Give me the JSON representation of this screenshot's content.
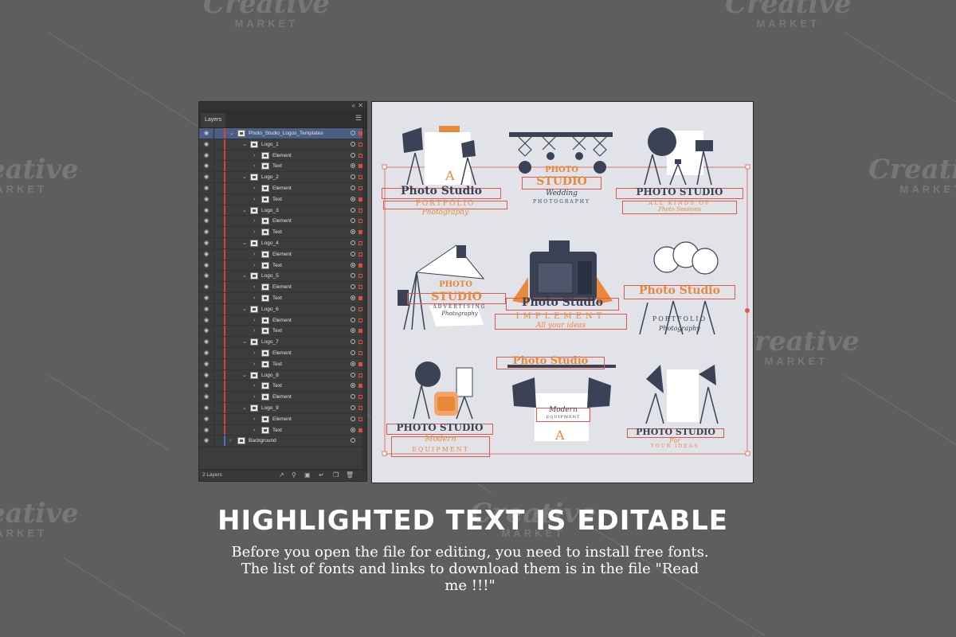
{
  "watermark": {
    "brand": "Creative",
    "sub": "MARKET"
  },
  "layers_panel": {
    "tab_label": "Layers",
    "footer_count": "2 Layers",
    "layers": [
      {
        "name": "Photo_Studio_Logos_Templates",
        "level": 0,
        "selected": true
      },
      {
        "name": "Logo_1",
        "level": 1
      },
      {
        "name": "Element",
        "level": 2
      },
      {
        "name": "Text",
        "level": 2
      },
      {
        "name": "Logo_2",
        "level": 1
      },
      {
        "name": "Element",
        "level": 2
      },
      {
        "name": "Text",
        "level": 2
      },
      {
        "name": "Logo_3",
        "level": 1
      },
      {
        "name": "Element",
        "level": 2
      },
      {
        "name": "Text",
        "level": 2
      },
      {
        "name": "Logo_4",
        "level": 1
      },
      {
        "name": "Element",
        "level": 2
      },
      {
        "name": "Text",
        "level": 2
      },
      {
        "name": "Logo_5",
        "level": 1
      },
      {
        "name": "Element",
        "level": 2
      },
      {
        "name": "Text",
        "level": 2
      },
      {
        "name": "Logo_6",
        "level": 1
      },
      {
        "name": "Element",
        "level": 2
      },
      {
        "name": "Text",
        "level": 2
      },
      {
        "name": "Logo_7",
        "level": 1
      },
      {
        "name": "Element",
        "level": 2
      },
      {
        "name": "Text",
        "level": 2
      },
      {
        "name": "Logo_8",
        "level": 1
      },
      {
        "name": "Text",
        "level": 2
      },
      {
        "name": "Element",
        "level": 2
      },
      {
        "name": "Logo_9",
        "level": 1
      },
      {
        "name": "Element",
        "level": 2
      },
      {
        "name": "Text",
        "level": 2
      },
      {
        "name": "Background",
        "level": 0,
        "blue": true
      }
    ]
  },
  "logos": {
    "l1": {
      "title": "Photo Studio",
      "sub": "PORTFOLIO",
      "script": "Photography"
    },
    "l2": {
      "top": "PHOTO",
      "main": "STUDIO",
      "script": "Wedding",
      "sub": "PHOTOGRAPHY"
    },
    "l3": {
      "title": "PHOTO STUDIO",
      "sub": "ALL KINDS OF",
      "script": "Photo Sessions"
    },
    "l4": {
      "top": "PHOTO",
      "main": "STUDIO",
      "sub": "ADVERTISING",
      "script": "Photography"
    },
    "l5": {
      "title": "Photo Studio",
      "sub": "IMPLEMENT",
      "script": "All your ideas"
    },
    "l6": {
      "title": "Photo Studio",
      "sub": "PORTFOLIO",
      "script": "Photography"
    },
    "l7": {
      "title": "PHOTO STUDIO",
      "script": "Modern",
      "sub": "EQUIPMENT"
    },
    "l8": {
      "title": "Photo Studio",
      "script": "Modern",
      "sub": "EQUIPMENT"
    },
    "l9": {
      "title": "PHOTO STUDIO",
      "script": "For",
      "sub": "YOUR IDEAS"
    }
  },
  "headline": "HIGHLIGHTED TEXT IS EDITABLE",
  "body": "Before you open the file for editing, you need to install free fonts. The list of fonts and links to download them is in the file \"Read me !!!\"",
  "colors": {
    "background": "#5e5e5e",
    "accent": "#e8883a",
    "selection": "#e0584c",
    "navy": "#3b4256"
  }
}
